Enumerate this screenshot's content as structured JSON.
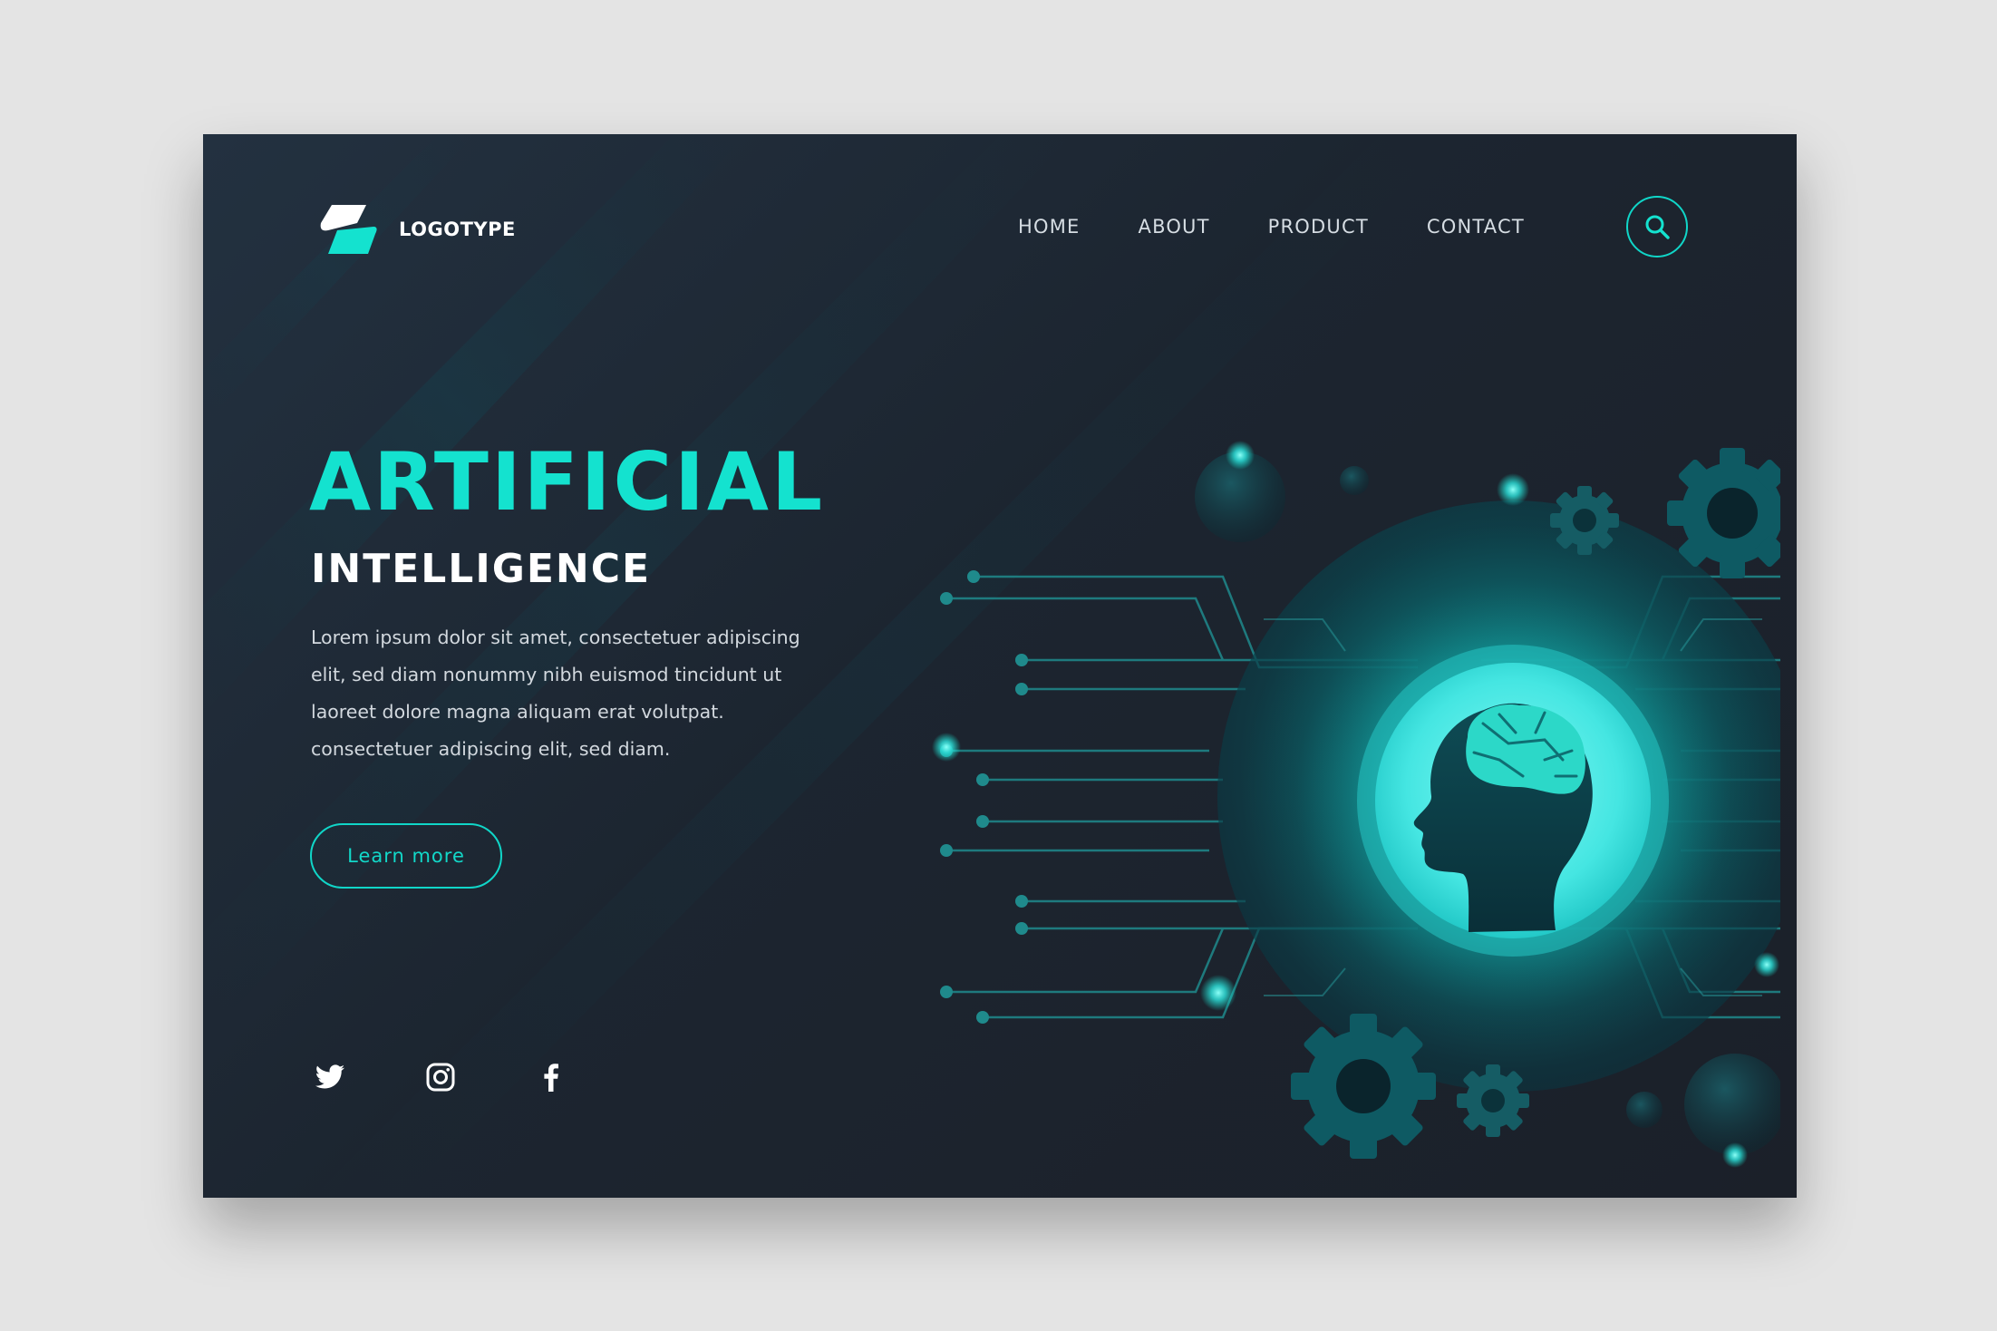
{
  "brand": {
    "logo_text": "LOGOTYPE",
    "accent_color": "#14e2cf",
    "background_color": "#1d2630",
    "page_background": "#e4e4e4"
  },
  "nav": {
    "items": [
      {
        "label": "HOME"
      },
      {
        "label": "ABOUT"
      },
      {
        "label": "PRODUCT"
      },
      {
        "label": "CONTACT"
      }
    ],
    "search_icon": "search-icon"
  },
  "hero": {
    "title": "ARTIFICIAL",
    "subtitle": "INTELLIGENCE",
    "body": "Lorem ipsum dolor sit amet, consectetuer adipiscing elit, sed diam nonummy nibh euismod tincidunt ut laoreet dolore magna aliquam erat volutpat. consectetuer adipiscing elit, sed diam.",
    "cta_label": "Learn more"
  },
  "social": {
    "icons": [
      "twitter-icon",
      "instagram-icon",
      "facebook-icon"
    ]
  },
  "illustration": {
    "subject": "head-with-brain-icon",
    "decorations": [
      "gear-icon",
      "circuit-lines",
      "glow-orbs"
    ]
  }
}
